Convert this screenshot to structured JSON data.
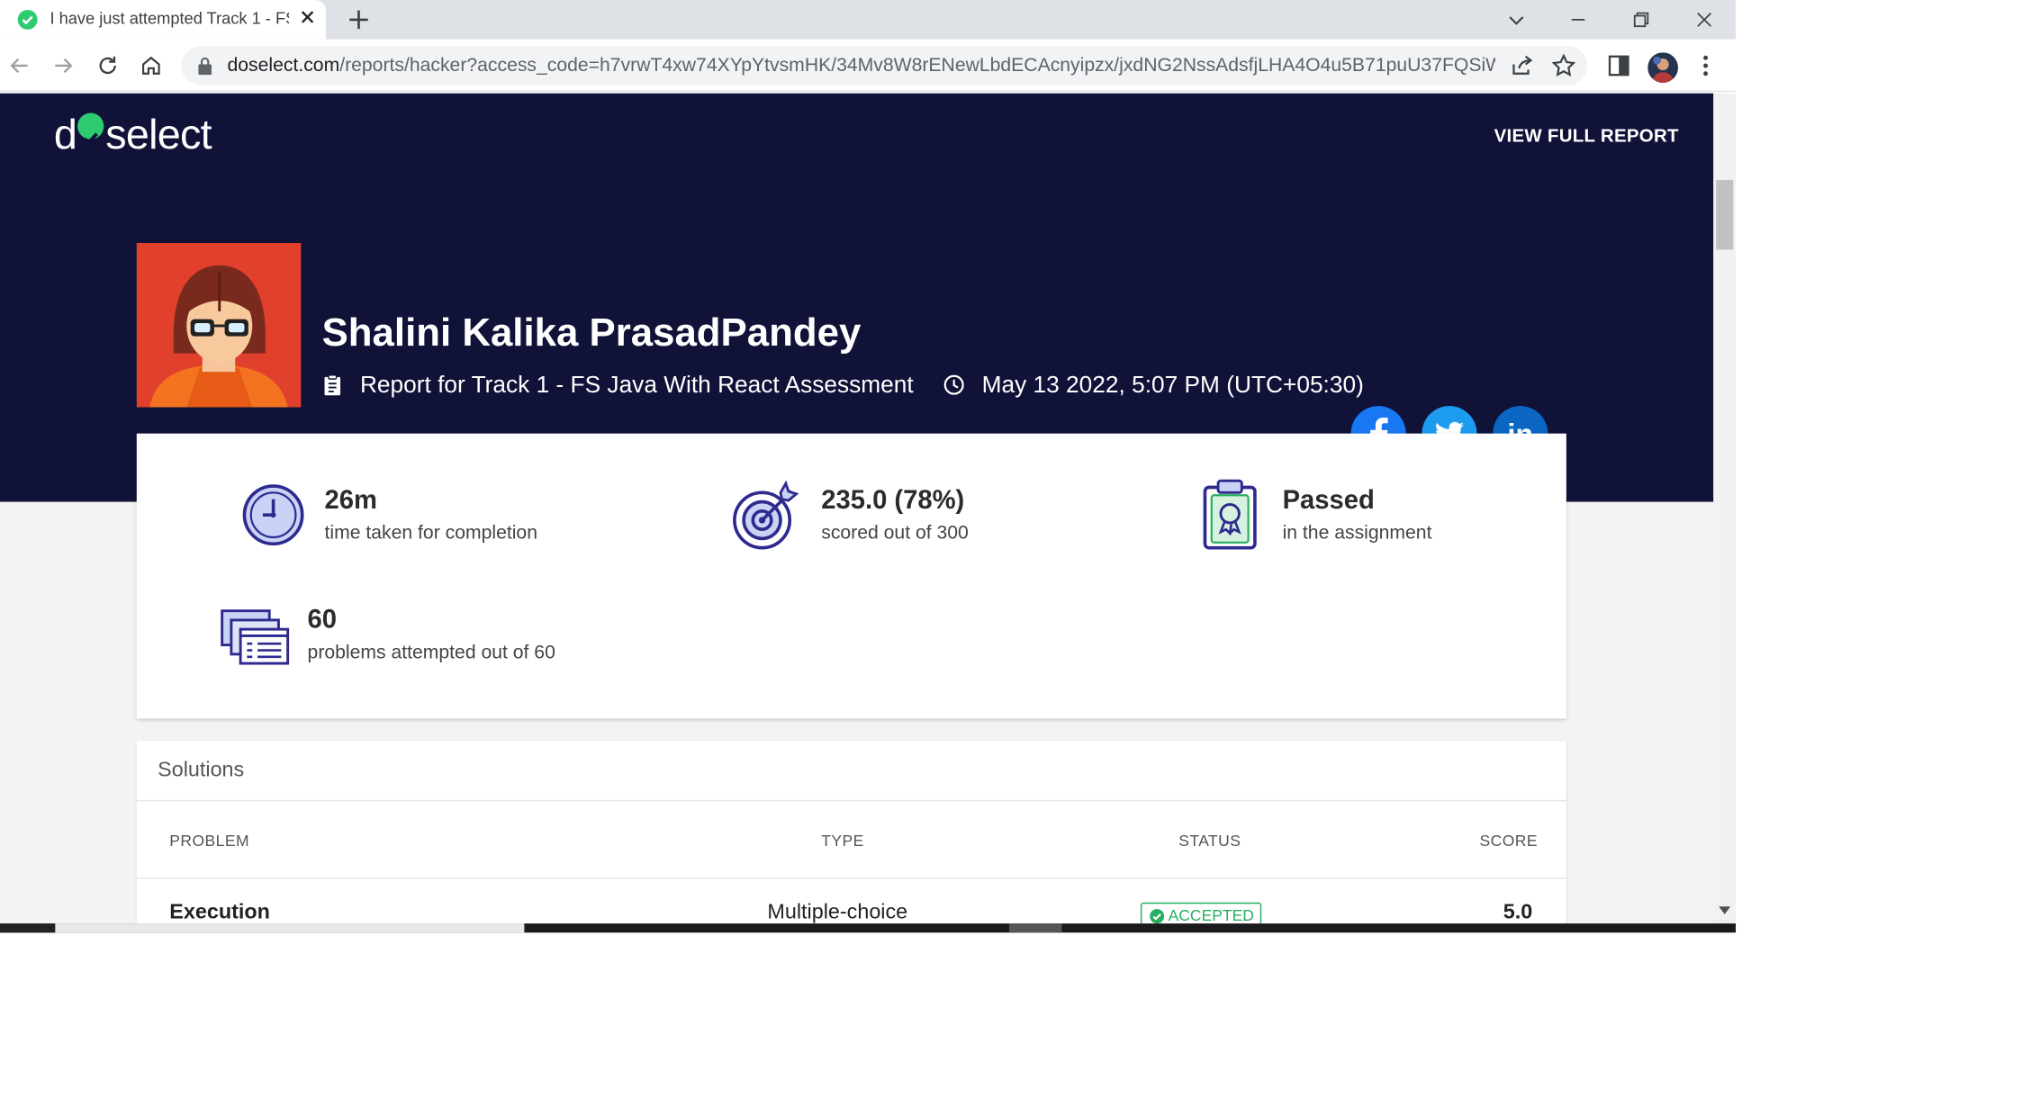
{
  "browser": {
    "tab_title": "I have just attempted Track 1 - FS",
    "url_host": "doselect.com",
    "url_path": "/reports/hacker?access_code=h7vrwT4xw74XYpYtvsmHK/34Mv8W8rENewLbdECAcnyipzx/jxdNG2NssAdsfjLHA4O4u5B71puU37FQSiW2..."
  },
  "header": {
    "logo_prefix": "d",
    "logo_suffix": "select",
    "view_full_report": "VIEW FULL REPORT"
  },
  "profile": {
    "name": "Shalini Kalika PrasadPandey",
    "report_for": "Report for Track 1 - FS Java With React Assessment",
    "datetime": "May 13 2022, 5:07 PM (UTC+05:30)"
  },
  "social": [
    "facebook-icon",
    "twitter-icon",
    "linkedin-icon"
  ],
  "colors": {
    "hero_bg": "#111238",
    "brand_green": "#2ecc71",
    "facebook": "#1877f2",
    "twitter": "#1d9bf0",
    "linkedin": "#0a66c2",
    "stat_icon": "#2f2a8e",
    "accepted": "#27ae60"
  },
  "stats": {
    "time": {
      "value": "26m",
      "label": "time taken for completion"
    },
    "score": {
      "value": "235.0 (78%)",
      "label": "scored out of 300"
    },
    "result": {
      "value": "Passed",
      "label": "in the assignment"
    },
    "attempted": {
      "value": "60",
      "label": "problems attempted out of 60"
    }
  },
  "solutions": {
    "title": "Solutions",
    "columns": [
      "PROBLEM",
      "TYPE",
      "STATUS",
      "SCORE"
    ],
    "rows": [
      {
        "problem": "Execution",
        "type": "Multiple-choice",
        "status": "ACCEPTED",
        "score": "5.0"
      }
    ]
  }
}
